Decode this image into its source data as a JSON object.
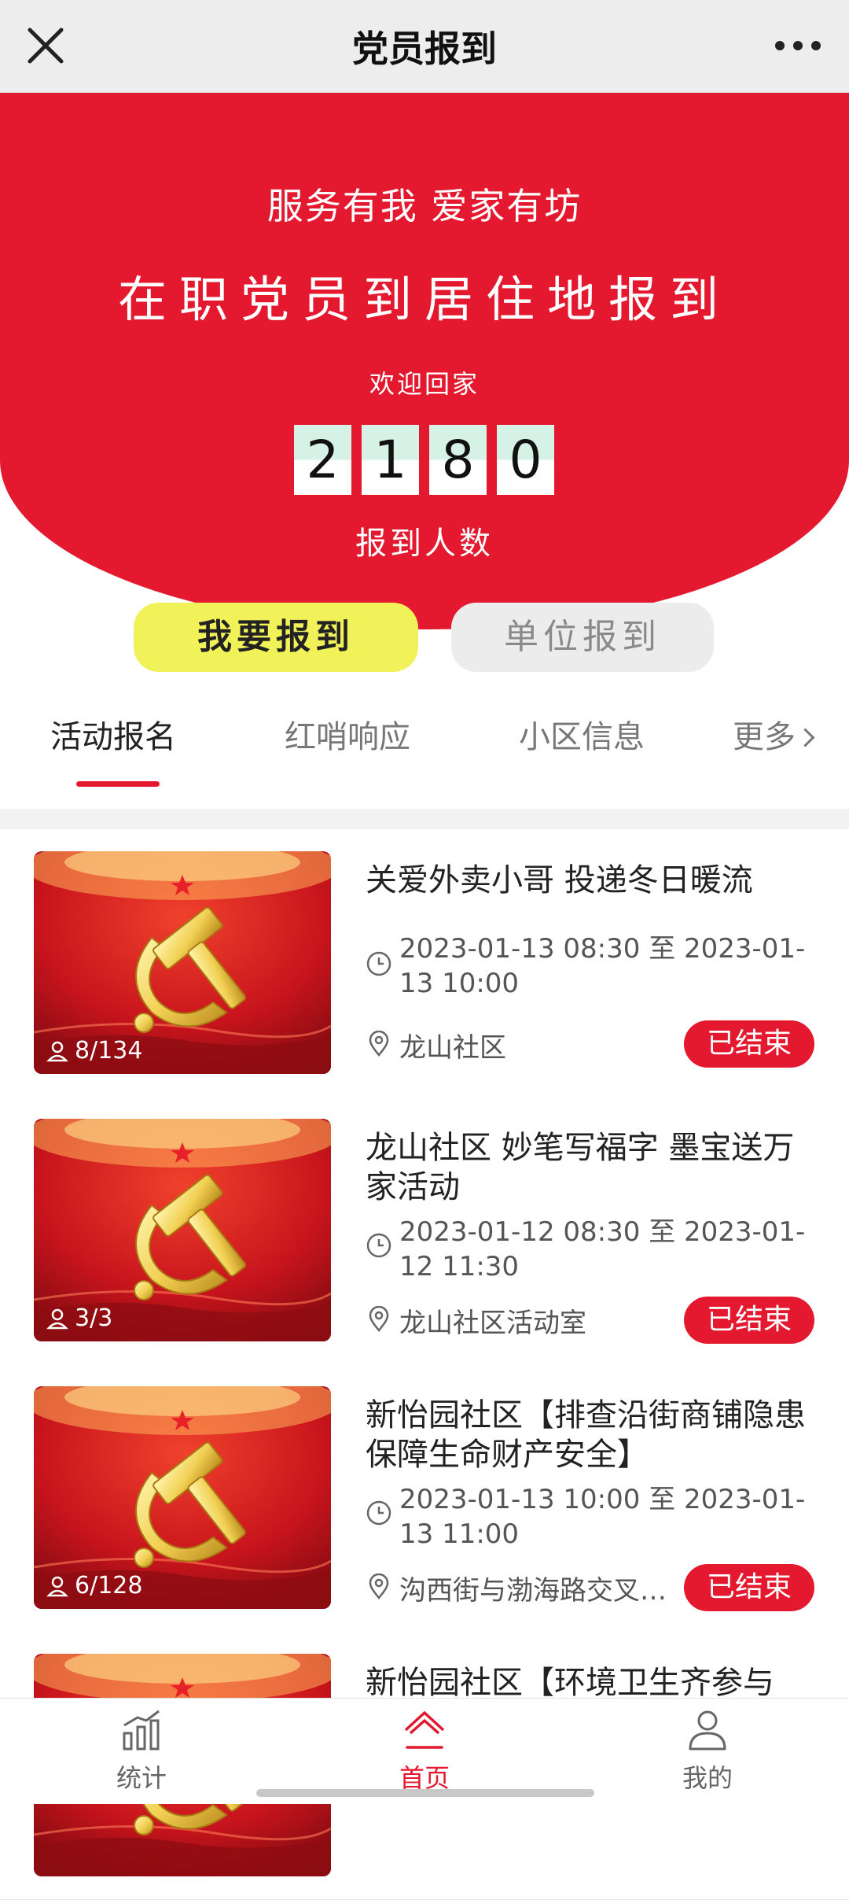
{
  "app": {
    "title": "党员报到",
    "close_icon": "close-icon",
    "more_icon": "more-dots-icon"
  },
  "hero": {
    "slogan": "服务有我  爱家有坊",
    "headline": "在职党员到居住地报到",
    "welcome": "欢迎回家",
    "count_digits": [
      "2",
      "1",
      "8",
      "0"
    ],
    "count_label": "报到人数",
    "background_color": "#e4192f"
  },
  "buttons": {
    "register_label": "我要报到",
    "unit_register_label": "单位报到"
  },
  "tabs": [
    {
      "label": "活动报名",
      "active": true
    },
    {
      "label": "红哨响应",
      "active": false
    },
    {
      "label": "小区信息",
      "active": false
    },
    {
      "label": "更多",
      "active": false
    }
  ],
  "activities": [
    {
      "title": "关爱外卖小哥 投递冬日暖流",
      "time": "2023-01-13 08:30 至 2023-01-13 10:00",
      "location": "龙山社区",
      "attendance": "8/134",
      "status": "已结束"
    },
    {
      "title": "龙山社区 妙笔写福字 墨宝送万家活动",
      "time": "2023-01-12 08:30 至 2023-01-12 11:30",
      "location": "龙山社区活动室",
      "attendance": "3/3",
      "status": "已结束"
    },
    {
      "title": "新怡园社区【排查沿街商铺隐患 保障生命财产安全】",
      "time": "2023-01-13 10:00 至 2023-01-13 11:00",
      "location": "沟西街与渤海路交叉…",
      "attendance": "6/128",
      "status": "已结束"
    },
    {
      "title": "新怡园社区【环境卫生齐参与",
      "time": "",
      "location": "",
      "attendance": "",
      "status": ""
    }
  ],
  "bottom_nav": [
    {
      "label": "统计",
      "icon": "stats-bar-icon",
      "active": false
    },
    {
      "label": "首页",
      "icon": "home-icon",
      "active": true
    },
    {
      "label": "我的",
      "icon": "user-icon",
      "active": false
    }
  ],
  "colors": {
    "accent": "#e4192f",
    "register_button": "#f1f25a",
    "unit_button": "#ececec"
  }
}
